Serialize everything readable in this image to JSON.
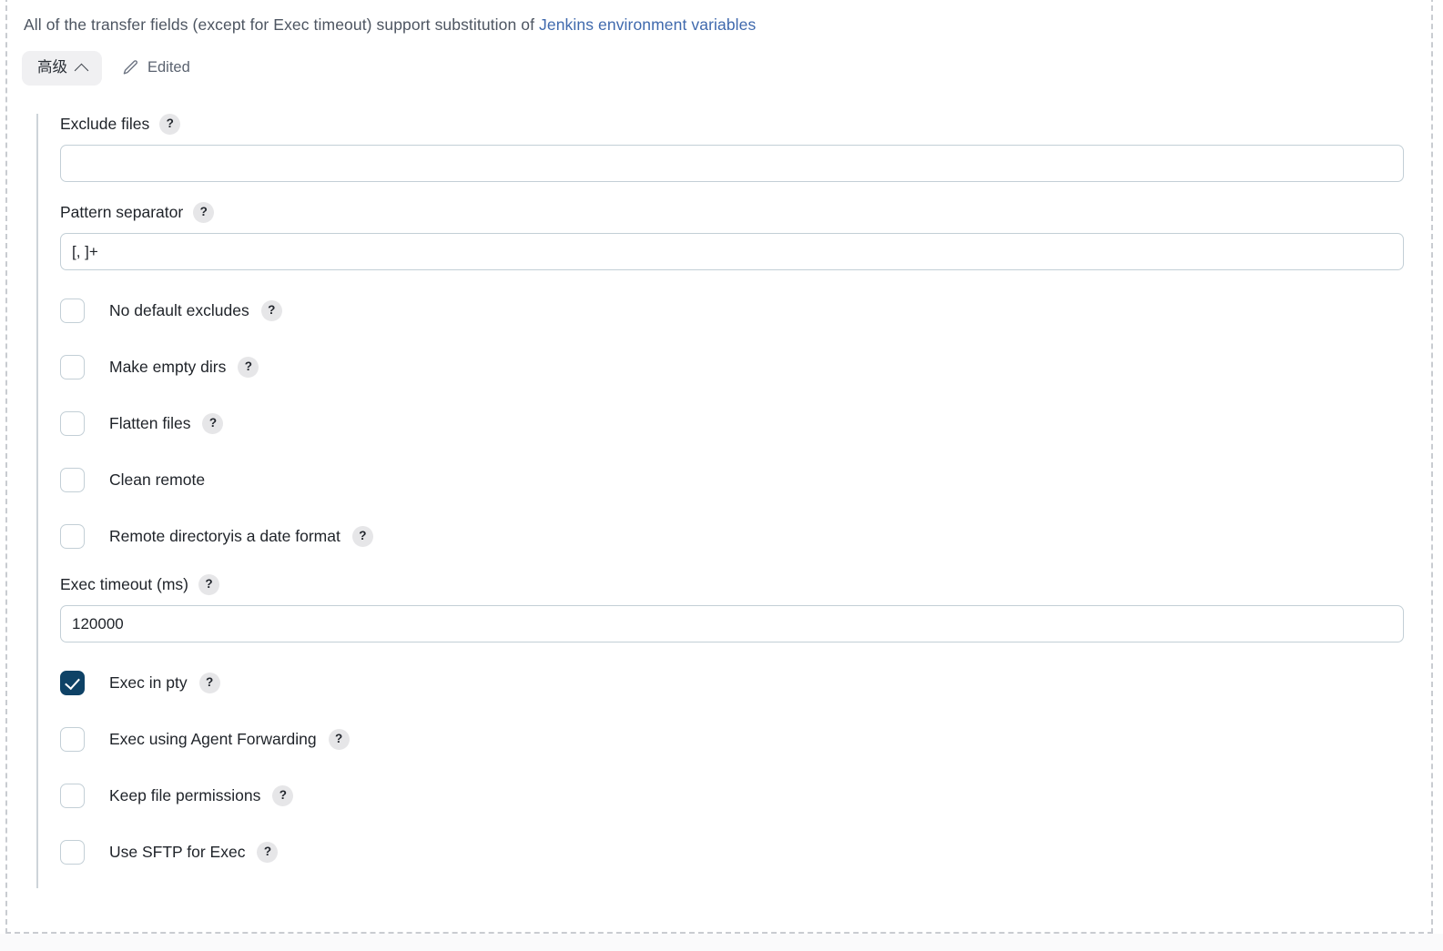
{
  "intro": {
    "text_before": "All of the transfer fields (except for Exec timeout) support substitution of ",
    "link_label": "Jenkins environment variables"
  },
  "advanced_bar": {
    "button_label": "高级",
    "chevron_icon": "chevron-up-icon",
    "edited_label": "Edited",
    "edited_icon": "pencil-icon"
  },
  "help_glyph": "?",
  "fields": {
    "exclude_files": {
      "label": "Exclude files",
      "value": "",
      "placeholder": "",
      "has_help": true
    },
    "pattern_separator": {
      "label": "Pattern separator",
      "value": "[, ]+",
      "placeholder": "",
      "has_help": true
    },
    "exec_timeout": {
      "label": "Exec timeout (ms)",
      "value": "120000",
      "placeholder": "",
      "has_help": true
    }
  },
  "checkboxes": [
    {
      "label": "No default excludes",
      "checked": false,
      "has_help": true
    },
    {
      "label": "Make empty dirs",
      "checked": false,
      "has_help": true
    },
    {
      "label": "Flatten files",
      "checked": false,
      "has_help": true
    },
    {
      "label": "Clean remote",
      "checked": false,
      "has_help": false
    },
    {
      "label": "Remote directoryis a date format",
      "checked": false,
      "has_help": true
    },
    {
      "label": "Exec in pty",
      "checked": true,
      "has_help": true
    },
    {
      "label": "Exec using Agent Forwarding",
      "checked": false,
      "has_help": true
    },
    {
      "label": "Keep file permissions",
      "checked": false,
      "has_help": true
    },
    {
      "label": "Use SFTP for Exec",
      "checked": false,
      "has_help": true
    }
  ],
  "colors": {
    "link": "#3f69ad",
    "checkbox_checked": "#0e4266",
    "input_border": "#c3cfd6",
    "help_badge_bg": "#e6e6e8",
    "advanced_button_bg": "#f0f0f2",
    "frame_dash": "#c9ccd1"
  }
}
